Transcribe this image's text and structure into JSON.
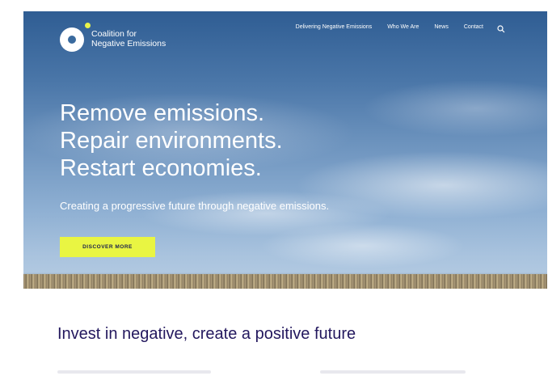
{
  "brand": {
    "name_line1": "Coalition for",
    "name_line2": "Negative Emissions",
    "accent_color": "#e9f542",
    "navy_color": "#23185e"
  },
  "nav": {
    "items": [
      {
        "label": "Delivering Negative Emissions"
      },
      {
        "label": "Who We Are"
      },
      {
        "label": "News"
      },
      {
        "label": "Contact"
      }
    ],
    "search_icon": "search-icon"
  },
  "hero": {
    "headline": [
      "Remove emissions.",
      "Repair environments.",
      "Restart economies."
    ],
    "subheadline": "Creating a progressive future through negative emissions.",
    "cta_label": "DISCOVER MORE"
  },
  "section": {
    "title": "Invest in negative, create a positive future"
  }
}
